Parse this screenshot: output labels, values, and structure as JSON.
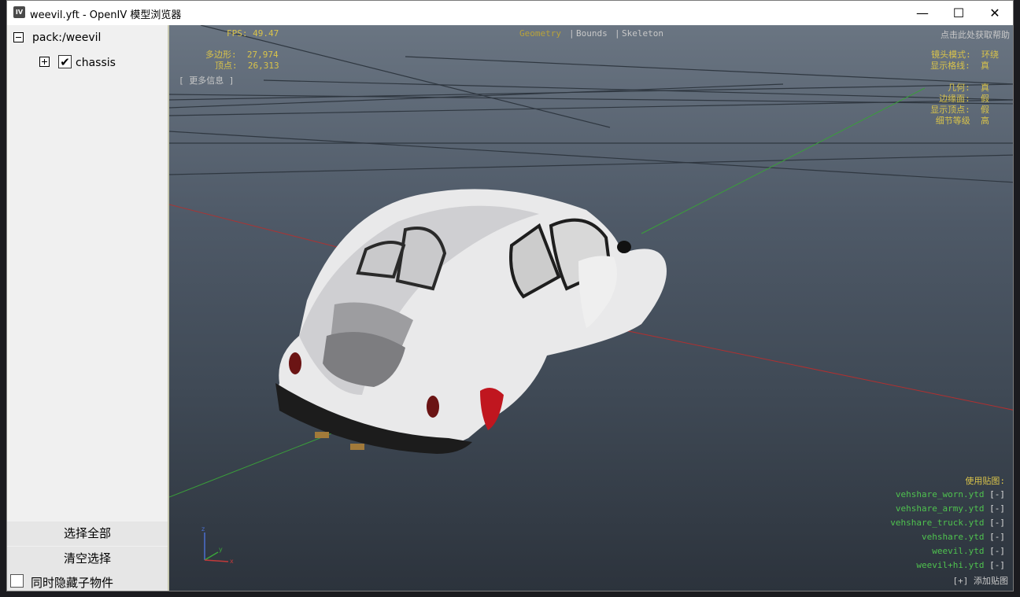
{
  "window": {
    "title": "weevil.yft - OpenIV 模型浏览器",
    "app_icon": "IV"
  },
  "controls": {
    "minimize": "—",
    "maximize": "☐",
    "close": "✕"
  },
  "tree": {
    "root": {
      "label": "pack:/weevil"
    },
    "child": {
      "label": "chassis",
      "checked": true
    }
  },
  "sidebar": {
    "select_all": "选择全部",
    "clear_selection": "清空选择",
    "hide_children": "同时隐藏子物件"
  },
  "hud": {
    "fps": "FPS: 49.47",
    "polygons": "多边形:  27,974",
    "vertices": "顶点:  26,313",
    "more_info": "[ 更多信息 ]",
    "tab_geometry": "Geometry",
    "tab_sep1": "|",
    "tab_bounds": "Bounds",
    "tab_sep2": "|",
    "tab_skeleton": "Skeleton",
    "help": "点击此处获取帮助",
    "camera_mode": "镜头模式:  环绕",
    "show_grid": "显示格线:  真",
    "geometry": "几何:  真",
    "edges": "边缘面:  假",
    "show_vertices": "显示顶点:  假",
    "lod": "细节等级  高",
    "textures_title": "使用贴图:",
    "textures": [
      "vehshare_worn.ytd",
      "vehshare_army.ytd",
      "vehshare_truck.ytd",
      "vehshare.ytd",
      "weevil.ytd",
      "weevil+hi.ytd"
    ],
    "remove": "[-]",
    "add_texture": "[+] 添加贴图"
  },
  "colors": {
    "hud_yellow": "#d9c34a",
    "texture_green": "#4fc24f",
    "axis_red": "#c23a3a",
    "axis_green": "#3aa63a"
  }
}
